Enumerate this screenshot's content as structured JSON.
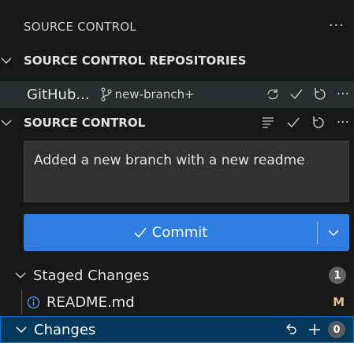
{
  "header": {
    "title": "SOURCE CONTROL",
    "more": "···"
  },
  "repositories_section": {
    "title": "SOURCE CONTROL REPOSITORIES"
  },
  "repository": {
    "name": "GitHub...",
    "branch": "new-branch+"
  },
  "source_control_section": {
    "title": "SOURCE CONTROL"
  },
  "commit_message": {
    "value": "Added a new branch with a new readme"
  },
  "commit_button": {
    "label": "Commit",
    "color": "#2f7de1"
  },
  "staged_changes": {
    "title": "Staged Changes",
    "count": "1",
    "files": [
      {
        "name": "README.md",
        "status": "M"
      }
    ]
  },
  "changes": {
    "title": "Changes",
    "count": "0"
  },
  "icons": {
    "more": "more-icon",
    "chevron": "chevron-down-icon",
    "branch": "git-branch-icon",
    "sync": "sync-icon",
    "check": "check-icon",
    "refresh": "refresh-icon",
    "view_list": "list-icon",
    "info": "info-icon",
    "discard": "discard-icon",
    "add": "add-icon"
  },
  "colors": {
    "background": "#181818",
    "accent": "#2f7de1",
    "modified": "#e2c08d",
    "selection": "#04395e"
  }
}
